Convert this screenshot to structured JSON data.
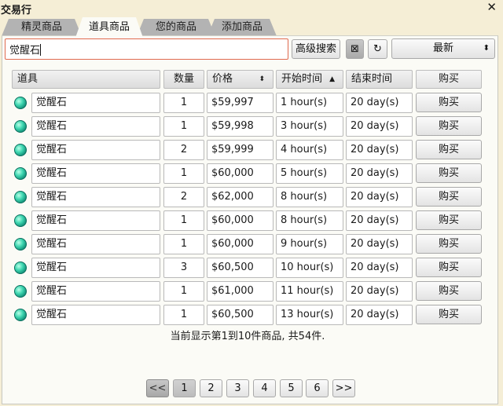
{
  "window": {
    "title": "交易行"
  },
  "tabs": [
    {
      "label": "精灵商品"
    },
    {
      "label": "道具商品"
    },
    {
      "label": "您的商品"
    },
    {
      "label": "添加商品"
    }
  ],
  "search": {
    "value": "觉醒石",
    "advanced_label": "高级搜索",
    "clear_icon": "⊠",
    "refresh_icon": "↻",
    "sort_selected": "最新",
    "sort_arrow": "⬍"
  },
  "table": {
    "headers": {
      "item": "道具",
      "qty": "数量",
      "price": "价格",
      "start": "开始时间",
      "end": "结束时间",
      "buy": "购买"
    },
    "rows": [
      {
        "name": "觉醒石",
        "qty": "1",
        "price": "$59,997",
        "start": "1 hour(s)",
        "end": "20 day(s)",
        "buy": "购买"
      },
      {
        "name": "觉醒石",
        "qty": "1",
        "price": "$59,998",
        "start": "3 hour(s)",
        "end": "20 day(s)",
        "buy": "购买"
      },
      {
        "name": "觉醒石",
        "qty": "2",
        "price": "$59,999",
        "start": "4 hour(s)",
        "end": "20 day(s)",
        "buy": "购买"
      },
      {
        "name": "觉醒石",
        "qty": "1",
        "price": "$60,000",
        "start": "5 hour(s)",
        "end": "20 day(s)",
        "buy": "购买"
      },
      {
        "name": "觉醒石",
        "qty": "2",
        "price": "$62,000",
        "start": "8 hour(s)",
        "end": "20 day(s)",
        "buy": "购买"
      },
      {
        "name": "觉醒石",
        "qty": "1",
        "price": "$60,000",
        "start": "8 hour(s)",
        "end": "20 day(s)",
        "buy": "购买"
      },
      {
        "name": "觉醒石",
        "qty": "1",
        "price": "$60,000",
        "start": "9 hour(s)",
        "end": "20 day(s)",
        "buy": "购买"
      },
      {
        "name": "觉醒石",
        "qty": "3",
        "price": "$60,500",
        "start": "10 hour(s)",
        "end": "20 day(s)",
        "buy": "购买"
      },
      {
        "name": "觉醒石",
        "qty": "1",
        "price": "$61,000",
        "start": "11 hour(s)",
        "end": "20 day(s)",
        "buy": "购买"
      },
      {
        "name": "觉醒石",
        "qty": "1",
        "price": "$60,500",
        "start": "13 hour(s)",
        "end": "20 day(s)",
        "buy": "购买"
      }
    ]
  },
  "status": "当前显示第1到10件商品, 共54件.",
  "pager": {
    "prev": "<<",
    "pages": [
      "1",
      "2",
      "3",
      "4",
      "5",
      "6"
    ],
    "next": ">>",
    "current": "1"
  }
}
